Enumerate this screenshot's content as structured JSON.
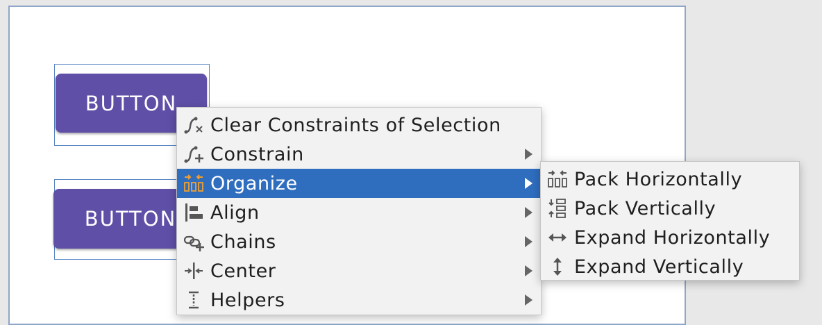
{
  "layout_buttons": [
    {
      "label": "BUTTON"
    },
    {
      "label": "BUTTON"
    }
  ],
  "context_menu": {
    "items": [
      {
        "label": "Clear Constraints of Selection",
        "icon": "clear-constraints-icon",
        "submenu": false
      },
      {
        "label": "Constrain",
        "icon": "constrain-icon",
        "submenu": true
      },
      {
        "label": "Organize",
        "icon": "organize-icon",
        "submenu": true,
        "highlighted": true
      },
      {
        "label": "Align",
        "icon": "align-icon",
        "submenu": true
      },
      {
        "label": "Chains",
        "icon": "chains-icon",
        "submenu": true
      },
      {
        "label": "Center",
        "icon": "center-icon",
        "submenu": true
      },
      {
        "label": "Helpers",
        "icon": "helpers-icon",
        "submenu": true
      }
    ]
  },
  "organize_submenu": {
    "items": [
      {
        "label": "Pack Horizontally",
        "icon": "pack-horizontally-icon"
      },
      {
        "label": "Pack Vertically",
        "icon": "pack-vertically-icon"
      },
      {
        "label": "Expand Horizontally",
        "icon": "expand-horizontally-icon"
      },
      {
        "label": "Expand Vertically",
        "icon": "expand-vertically-icon"
      }
    ]
  },
  "colors": {
    "button_bg": "#5f4fa7",
    "highlight": "#2f6dbf",
    "selection_border": "#5a86c4",
    "menu_bg": "#f2f2f2"
  }
}
